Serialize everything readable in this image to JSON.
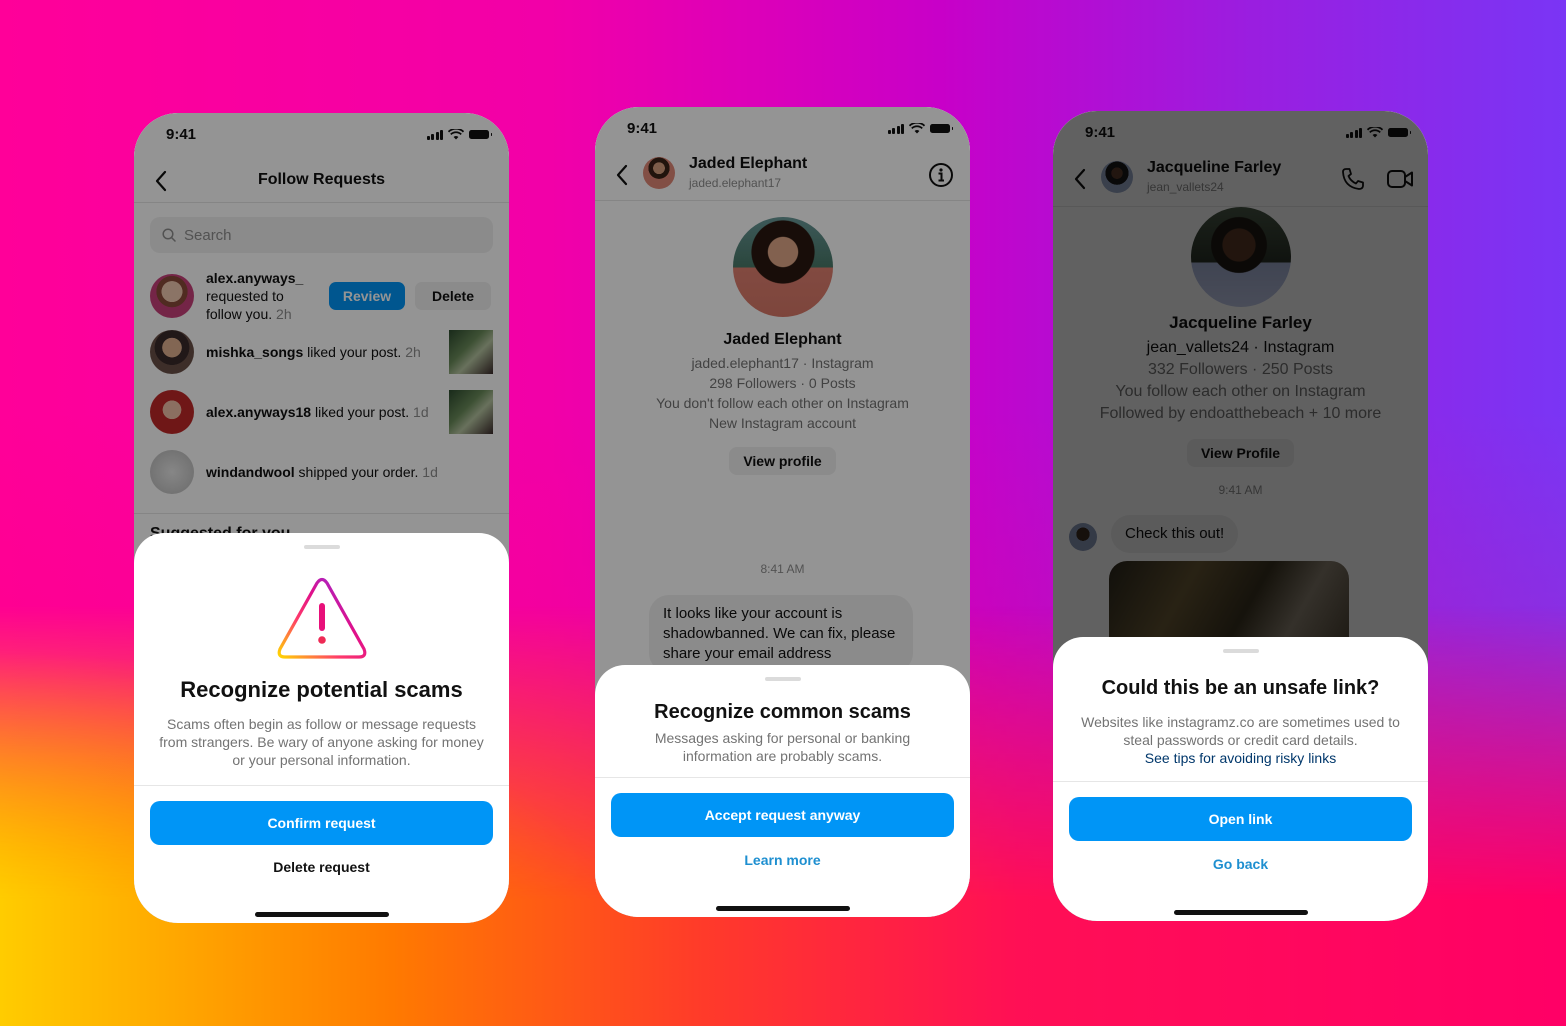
{
  "colors": {
    "primary_button": "#0095f6",
    "link_blue": "#0095f6",
    "link_dark": "#00376b",
    "background_gradient": [
      "#ff0099",
      "#c800c8",
      "#7a35f5",
      "#ffcc00",
      "#ff7a00",
      "#ff0066"
    ]
  },
  "phones": [
    {
      "status_time": "9:41",
      "nav_title": "Follow Requests",
      "search_placeholder": "Search",
      "request": {
        "username": "alex.anyways_",
        "text_line1": "requested to",
        "text_line2": "follow you.",
        "time": "2h",
        "review_label": "Review",
        "delete_label": "Delete"
      },
      "activity": [
        {
          "username": "mishka_songs",
          "text": "liked your post.",
          "time": "2h",
          "has_thumb": true
        },
        {
          "username": "alex.anyways18",
          "text": "liked your post.",
          "time": "1d",
          "has_thumb": true
        },
        {
          "username": "windandwool",
          "text": "shipped your order.",
          "time": "1d",
          "has_thumb": false
        }
      ],
      "section_heading": "Suggested for you",
      "sheet": {
        "icon": "warning-triangle-icon",
        "title": "Recognize potential scams",
        "body": "Scams often begin as follow or message requests from strangers. Be wary of anyone asking for money or your personal information.",
        "primary_label": "Confirm request",
        "secondary_label": "Delete request"
      }
    },
    {
      "status_time": "9:41",
      "header_name": "Jaded Elephant",
      "header_username": "jaded.elephant17",
      "profile": {
        "name": "Jaded Elephant",
        "lines": [
          "jaded.elephant17 · Instagram",
          "298 Followers · 0 Posts",
          "You don't follow each other on Instagram",
          "New Instagram account"
        ],
        "view_label": "View profile"
      },
      "timestamp": "8:41 AM",
      "message": "It looks like your account is shadowbanned. We can fix, please share your email address",
      "sheet": {
        "title": "Recognize common scams",
        "body": "Messages asking for personal or banking information are probably scams.",
        "primary_label": "Accept request anyway",
        "secondary_label": "Learn more"
      }
    },
    {
      "status_time": "9:41",
      "header_name": "Jacqueline Farley",
      "header_username": "jean_vallets24",
      "profile": {
        "name": "Jacqueline Farley",
        "line_handle": "jean_vallets24 · Instagram",
        "lines": [
          "332 Followers · 250 Posts",
          "You follow each other on Instagram",
          "Followed by endoatthebeach + 10 more"
        ],
        "view_label": "View Profile"
      },
      "timestamp": "9:41 AM",
      "message": "Check this out!",
      "sheet": {
        "title": "Could this be an unsafe link?",
        "body": "Websites like instagramz.co are sometimes used to steal passwords or credit card details.",
        "link_text": "See tips for avoiding risky links",
        "primary_label": "Open link",
        "secondary_label": "Go back"
      }
    }
  ]
}
